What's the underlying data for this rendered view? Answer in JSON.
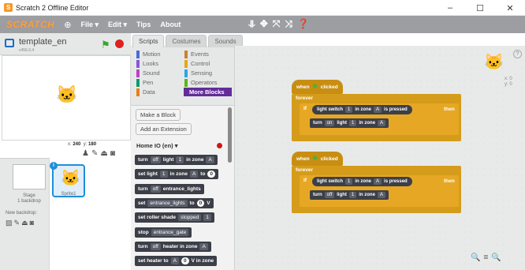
{
  "window": {
    "title": "Scratch 2 Offline Editor",
    "minimize": "–",
    "maximize": "☐",
    "close": "✕"
  },
  "menubar": {
    "logo": "SCRATCH",
    "file": "File ▾",
    "edit": "Edit ▾",
    "tips": "Tips",
    "about": "About"
  },
  "stage": {
    "project_name": "template_en",
    "version": "v456.0.4",
    "coords_x_label": "x:",
    "coords_x": "240",
    "coords_y_label": "y:",
    "coords_y": "180"
  },
  "sprites": {
    "stage_label": "Stage",
    "stage_sub": "1 backdrop",
    "new_backdrop": "New backdrop:",
    "sprite_name": "Sprite1"
  },
  "tabs": [
    "Scripts",
    "Costumes",
    "Sounds"
  ],
  "categories": [
    {
      "label": "Motion",
      "color": "#4a6cd4"
    },
    {
      "label": "Events",
      "color": "#c88330"
    },
    {
      "label": "Looks",
      "color": "#8a55d7"
    },
    {
      "label": "Control",
      "color": "#e1a91a"
    },
    {
      "label": "Sound",
      "color": "#bb42c3"
    },
    {
      "label": "Sensing",
      "color": "#2ca5e2"
    },
    {
      "label": "Pen",
      "color": "#0e9a6c"
    },
    {
      "label": "Operators",
      "color": "#5cb712"
    },
    {
      "label": "Data",
      "color": "#ee7d16"
    },
    {
      "label": "More Blocks",
      "color": "#632d99"
    }
  ],
  "palette": {
    "make_block": "Make a Block",
    "add_extension": "Add an Extension",
    "extension_name": "Home IO (en) ▾",
    "blocks": [
      {
        "a": "turn",
        "b": "off",
        "c": "light",
        "d": "1",
        "e": "in zone",
        "f": "A"
      },
      {
        "a": "set light",
        "d": "1",
        "e": "in zone",
        "f": "A",
        "g": "to",
        "n": "0"
      },
      {
        "a": "turn",
        "b": "off",
        "c": "entrance_lights"
      },
      {
        "a": "set",
        "b": "entrance_lights",
        "g": "to",
        "n": "0",
        "h": "V"
      },
      {
        "a": "set roller shade",
        "d": "1",
        "b": "stopped"
      },
      {
        "a": "stop",
        "b": "entrance_gate"
      },
      {
        "a": "turn",
        "b": "off",
        "c": "heater in zone",
        "f": "A"
      },
      {
        "a": "set heater to",
        "n": "0",
        "h": "V in zone",
        "f": "A"
      }
    ]
  },
  "scripts": [
    {
      "hat": "when",
      "hat_suffix": "clicked",
      "forever": "forever",
      "if": "if",
      "cond": {
        "a": "light switch",
        "d": "1",
        "e": "in zone",
        "f": "A",
        "g": "is pressed"
      },
      "then": "then",
      "action": {
        "a": "turn",
        "b": "on",
        "c": "light",
        "d": "1",
        "e": "in zone",
        "f": "A"
      }
    },
    {
      "hat": "when",
      "hat_suffix": "clicked",
      "forever": "forever",
      "if": "if",
      "cond": {
        "a": "light switch",
        "d": "1",
        "e": "in zone",
        "f": "A",
        "g": "is pressed"
      },
      "then": "then",
      "action": {
        "a": "turn",
        "b": "off",
        "c": "light",
        "d": "1",
        "e": "in zone",
        "f": "A"
      }
    }
  ],
  "script_area": {
    "x_label": "x: 0",
    "y_label": "y: 0",
    "zoom_out": "🔍−",
    "zoom_reset": "=",
    "zoom_in": "🔍+"
  }
}
